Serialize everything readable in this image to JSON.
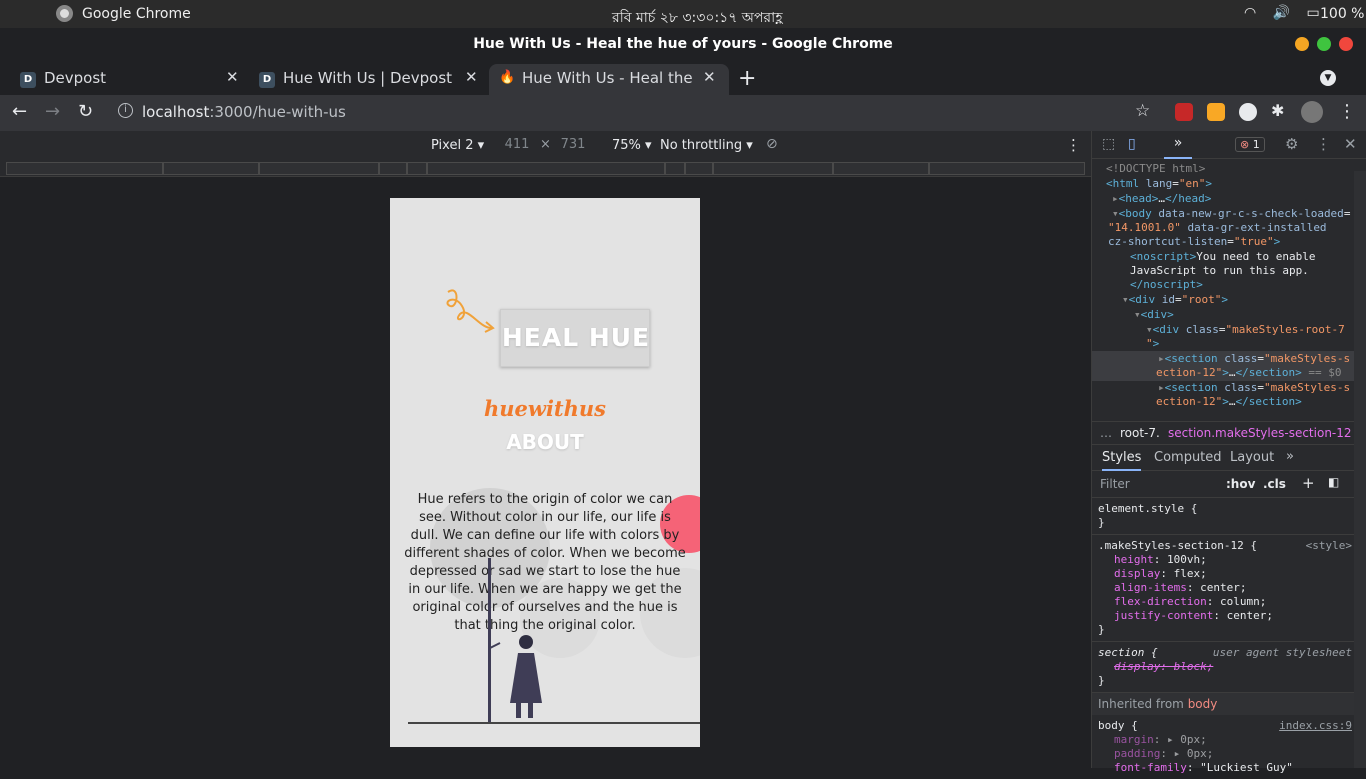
{
  "os": {
    "app_name": "Google Chrome",
    "clock": "রবি মার্চ ২৮  ৩:৩০:১৭ অপরাহ্ণ",
    "battery": "100 %"
  },
  "window": {
    "title": "Hue With Us - Heal the hue of yours - Google Chrome"
  },
  "tabs": [
    {
      "label": "Devpost",
      "favicon": "D"
    },
    {
      "label": "Hue With Us | Devpost",
      "favicon": "D"
    },
    {
      "label": "Hue With Us - Heal the hue of yours",
      "favicon": "flame-icon"
    }
  ],
  "address": {
    "host": "localhost",
    "path": ":3000/hue-with-us"
  },
  "device_toolbar": {
    "device": "Pixel 2",
    "width": "411",
    "height": "731",
    "zoom": "75%",
    "throttle": "No throttling"
  },
  "page": {
    "heal_title": "HEAL HUE",
    "brand": "huewithus",
    "about": "ABOUT",
    "paragraph": "Hue refers to the origin of color we can see. Without color in our life, our life is dull. We can define our life with colors by different shades of color. When we become depressed or sad we start to lose the hue in our life. When we are happy we get the original color of ourselves and the hue is that thing the original color."
  },
  "devtools": {
    "error_count": "1",
    "dom": {
      "doctype": "<!DOCTYPE html>",
      "html_lang": "en",
      "noscript_text": "You need to enable",
      "noscript_text2": "JavaScript to run this app.",
      "root_id": "root",
      "body_attr1": "14.1001.0",
      "class_root": "makeStyles-root-7",
      "class_section": "makeStyles-section-12",
      "section_suffix": "ection-12",
      "eq0": "== $0"
    },
    "breadcrumb": {
      "item1": "root-7.",
      "item2": "section.makeStyles-section-12"
    },
    "style_tabs": [
      "Styles",
      "Computed",
      "Layout"
    ],
    "filter_placeholder": "Filter",
    "hov": ":hov",
    "cls": ".cls",
    "rules": {
      "element_style": "element.style {",
      "section_selector": ".makeStyles-section-12 {",
      "section_src": "<style>",
      "decls": [
        {
          "p": "height",
          "v": "100vh;"
        },
        {
          "p": "display",
          "v": "flex;"
        },
        {
          "p": "align-items",
          "v": "center;"
        },
        {
          "p": "flex-direction",
          "v": "column;"
        },
        {
          "p": "justify-content",
          "v": "center;"
        }
      ],
      "ua_selector": "section {",
      "ua_src": "user agent stylesheet",
      "ua_decl": "display: block;",
      "inherited_label": "Inherited from",
      "inherited_tag": "body",
      "body_selector": "body {",
      "body_src": "index.css:9",
      "body_decls": [
        {
          "p": "margin",
          "v": "▸ 0px;"
        },
        {
          "p": "padding",
          "v": "▸ 0px;"
        },
        {
          "p": "font-family",
          "v": "\"Luckiest Guy\""
        }
      ]
    }
  }
}
